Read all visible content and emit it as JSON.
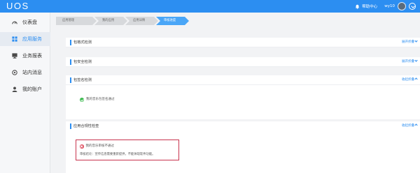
{
  "header": {
    "logo": "UOS",
    "help_center": "帮助中心",
    "username": "wy10",
    "brand_color": "#2c8ef1"
  },
  "sidebar": {
    "items": [
      {
        "label": "仪表盘",
        "icon": "dashboard-icon",
        "active": false
      },
      {
        "label": "应用服务",
        "icon": "grid-icon",
        "active": true
      },
      {
        "label": "业务报表",
        "icon": "report-icon",
        "active": false
      },
      {
        "label": "站内消息",
        "icon": "message-icon",
        "active": false
      },
      {
        "label": "我的账户",
        "icon": "user-icon",
        "active": false
      }
    ]
  },
  "breadcrumb": [
    {
      "label": "应用管理",
      "active": false
    },
    {
      "label": "我的应用",
      "active": false
    },
    {
      "label": "应用详情",
      "active": false
    },
    {
      "label": "审核进度",
      "active": true
    }
  ],
  "cards": [
    {
      "title": "包格式检测",
      "toggle": "展开折叠"
    },
    {
      "title": "包安全检测",
      "toggle": "展开折叠"
    },
    {
      "title": "包签名检测",
      "toggle": "收起折叠",
      "status": "我的音乐包签名通过"
    },
    {
      "title": "应用合规性检查",
      "toggle": "收起折叠",
      "status": "我的音乐审核不通过",
      "detail": "审核结论：宣传信息需要重新提供，不能体现软件功能。",
      "status_color": "#c8334d"
    }
  ]
}
